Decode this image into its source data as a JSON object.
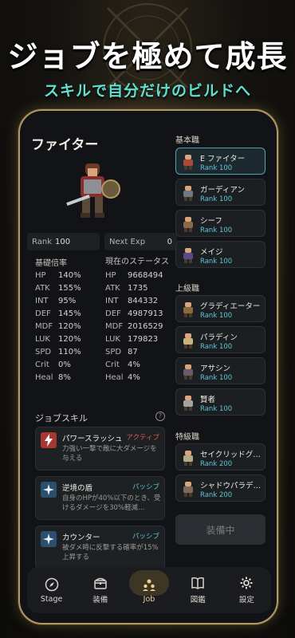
{
  "headline": "ジョブを極めて成長",
  "subline": "スキルで自分だけのビルドへ",
  "detail": {
    "job_name": "ファイター",
    "rank_label": "Rank",
    "rank_value": "100",
    "next_exp_label": "Next Exp",
    "next_exp_value": "0",
    "base_multiplier_title": "基礎倍率",
    "current_status_title": "現在のステータス",
    "base_stats": [
      {
        "key": "HP",
        "value": "140%"
      },
      {
        "key": "ATK",
        "value": "155%"
      },
      {
        "key": "INT",
        "value": "95%"
      },
      {
        "key": "DEF",
        "value": "145%"
      },
      {
        "key": "MDF",
        "value": "120%"
      },
      {
        "key": "LUK",
        "value": "120%"
      },
      {
        "key": "SPD",
        "value": "110%"
      },
      {
        "key": "Crit",
        "value": "0%"
      },
      {
        "key": "Heal",
        "value": "8%"
      }
    ],
    "current_stats": [
      {
        "key": "HP",
        "value": "9668494"
      },
      {
        "key": "ATK",
        "value": "1735"
      },
      {
        "key": "INT",
        "value": "844332"
      },
      {
        "key": "DEF",
        "value": "4987913"
      },
      {
        "key": "MDF",
        "value": "2016529"
      },
      {
        "key": "LUK",
        "value": "179823"
      },
      {
        "key": "SPD",
        "value": "87"
      },
      {
        "key": "Crit",
        "value": "4%"
      },
      {
        "key": "Heal",
        "value": "4%"
      }
    ],
    "skills_title": "ジョブスキル",
    "help_glyph": "?",
    "skills": [
      {
        "name": "パワースラッシュ",
        "tag": "アクティブ",
        "tag_color": "#e0584e",
        "icon_color": "#a83631",
        "desc": "力強い一撃で敵に大ダメージを与える"
      },
      {
        "name": "逆境の盾",
        "tag": "パッシブ",
        "tag_color": "#5ec5d8",
        "icon_color": "#2d4f6e",
        "desc": "自身のHPが40%以下のとき、受けるダメージを30%軽減…"
      },
      {
        "name": "カウンター",
        "tag": "パッシブ",
        "tag_color": "#5ec5d8",
        "icon_color": "#2d4f6e",
        "desc": "被ダメ時に反撃する確率が15%上昇する"
      }
    ]
  },
  "job_list": {
    "basic_title": "基本職",
    "advanced_title": "上級職",
    "special_title": "特級職",
    "basic": [
      {
        "name": "E ファイター",
        "rank": "Rank 100",
        "selected": true
      },
      {
        "name": "ガーディアン",
        "rank": "Rank 100"
      },
      {
        "name": "シーフ",
        "rank": "Rank 100"
      },
      {
        "name": "メイジ",
        "rank": "Rank 100"
      }
    ],
    "advanced": [
      {
        "name": "グラディエーター",
        "rank": "Rank 100"
      },
      {
        "name": "パラディン",
        "rank": "Rank 100"
      },
      {
        "name": "アサシン",
        "rank": "Rank 100"
      },
      {
        "name": "賢者",
        "rank": "Rank 100"
      }
    ],
    "special": [
      {
        "name": "セイクリッドグ…",
        "rank": "Rank 200"
      },
      {
        "name": "シャドウパラデ…",
        "rank": "Rank 200"
      }
    ],
    "equip_button": "装備中"
  },
  "nav": [
    {
      "label": "Stage",
      "icon": "compass-icon"
    },
    {
      "label": "装備",
      "icon": "chest-icon"
    },
    {
      "label": "Job",
      "icon": "people-icon",
      "active": true
    },
    {
      "label": "図鑑",
      "icon": "book-icon"
    },
    {
      "label": "設定",
      "icon": "gear-icon"
    }
  ],
  "colors": {
    "accent": "#5fe0d0",
    "gold": "#b39a63",
    "rank": "#5ec5d8",
    "active_tag": "#e0584e"
  }
}
